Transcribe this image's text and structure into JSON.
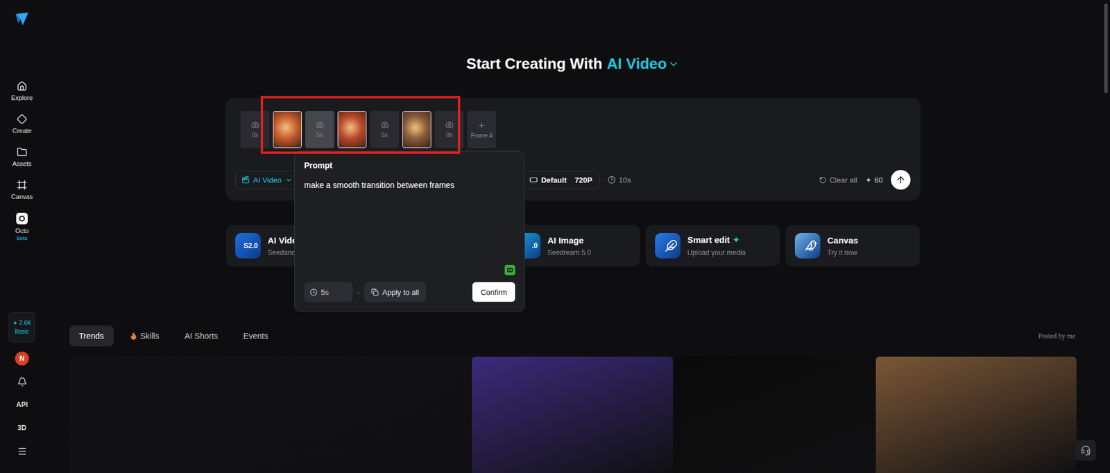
{
  "sidebar": {
    "items": [
      {
        "label": "Explore",
        "selected": false,
        "kind": "house"
      },
      {
        "label": "Create",
        "selected": false,
        "kind": "diamond"
      },
      {
        "label": "Assets",
        "selected": false,
        "kind": "folder"
      },
      {
        "label": "Canvas",
        "selected": false,
        "kind": "frame"
      },
      {
        "label": "Octo",
        "selected": false,
        "kind": "octo",
        "badge": "Beta"
      }
    ],
    "credits": {
      "icon": "✦",
      "amount": "2.6K",
      "plan": "Basic"
    },
    "avatar": "N",
    "links": [
      "API",
      "3D"
    ]
  },
  "title": {
    "text": "Start Creating With",
    "mode": "AI Video"
  },
  "frames": [
    {
      "kind": "slot",
      "label": "0s",
      "selected": false
    },
    {
      "kind": "image",
      "color": "#c65a2b"
    },
    {
      "kind": "slot",
      "label": "5s",
      "selected": true
    },
    {
      "kind": "image",
      "color": "#b8462a"
    },
    {
      "kind": "slot",
      "label": "5s",
      "selected": false
    },
    {
      "kind": "image",
      "color": "#8a5a3a"
    },
    {
      "kind": "slot",
      "label": "0s",
      "selected": false
    }
  ],
  "add_frame": {
    "icon": "+",
    "label": "Frame 4"
  },
  "toolbar": {
    "mode": "AI Video",
    "ratio": "Default",
    "resolution": "720P",
    "duration": "10s",
    "clear": "Clear all",
    "cost_icon": "✦",
    "cost": "60"
  },
  "prompt_popover": {
    "title": "Prompt",
    "text": "make a smooth transition between frames",
    "duration": "5s",
    "separator": "-",
    "apply": "Apply to all",
    "confirm": "Confirm"
  },
  "cards": [
    {
      "kind": "label",
      "title": "AI Vide",
      "subtitle": "Seedanc",
      "icon_label": "S2.0",
      "color": "#1f6fe0"
    },
    {
      "kind": "label",
      "title": "AI Image",
      "subtitle": "Seedream 5.0",
      "icon_label": ".0",
      "color": "#1aa0d8"
    },
    {
      "kind": "feather",
      "title": "Smart edit",
      "badge": "✦",
      "subtitle": "Upload your media",
      "color": "#2a7de8"
    },
    {
      "kind": "bird",
      "title": "Canvas",
      "subtitle": "Try it now",
      "color": "#6fb2ea"
    }
  ],
  "tabs": [
    {
      "label": "Trends",
      "selected": true,
      "kind": "plain"
    },
    {
      "label": "Skills",
      "selected": false,
      "kind": "flame"
    },
    {
      "label": "AI Shorts",
      "selected": false,
      "kind": "plain"
    },
    {
      "label": "Events",
      "selected": false,
      "kind": "plain"
    }
  ],
  "posted_by": "Posted by me",
  "gallery": [
    {
      "color": "#121216"
    },
    {
      "color": "#3b2a7a"
    },
    {
      "color": "#0a0a0a"
    },
    {
      "color": "#7a5636"
    }
  ]
}
